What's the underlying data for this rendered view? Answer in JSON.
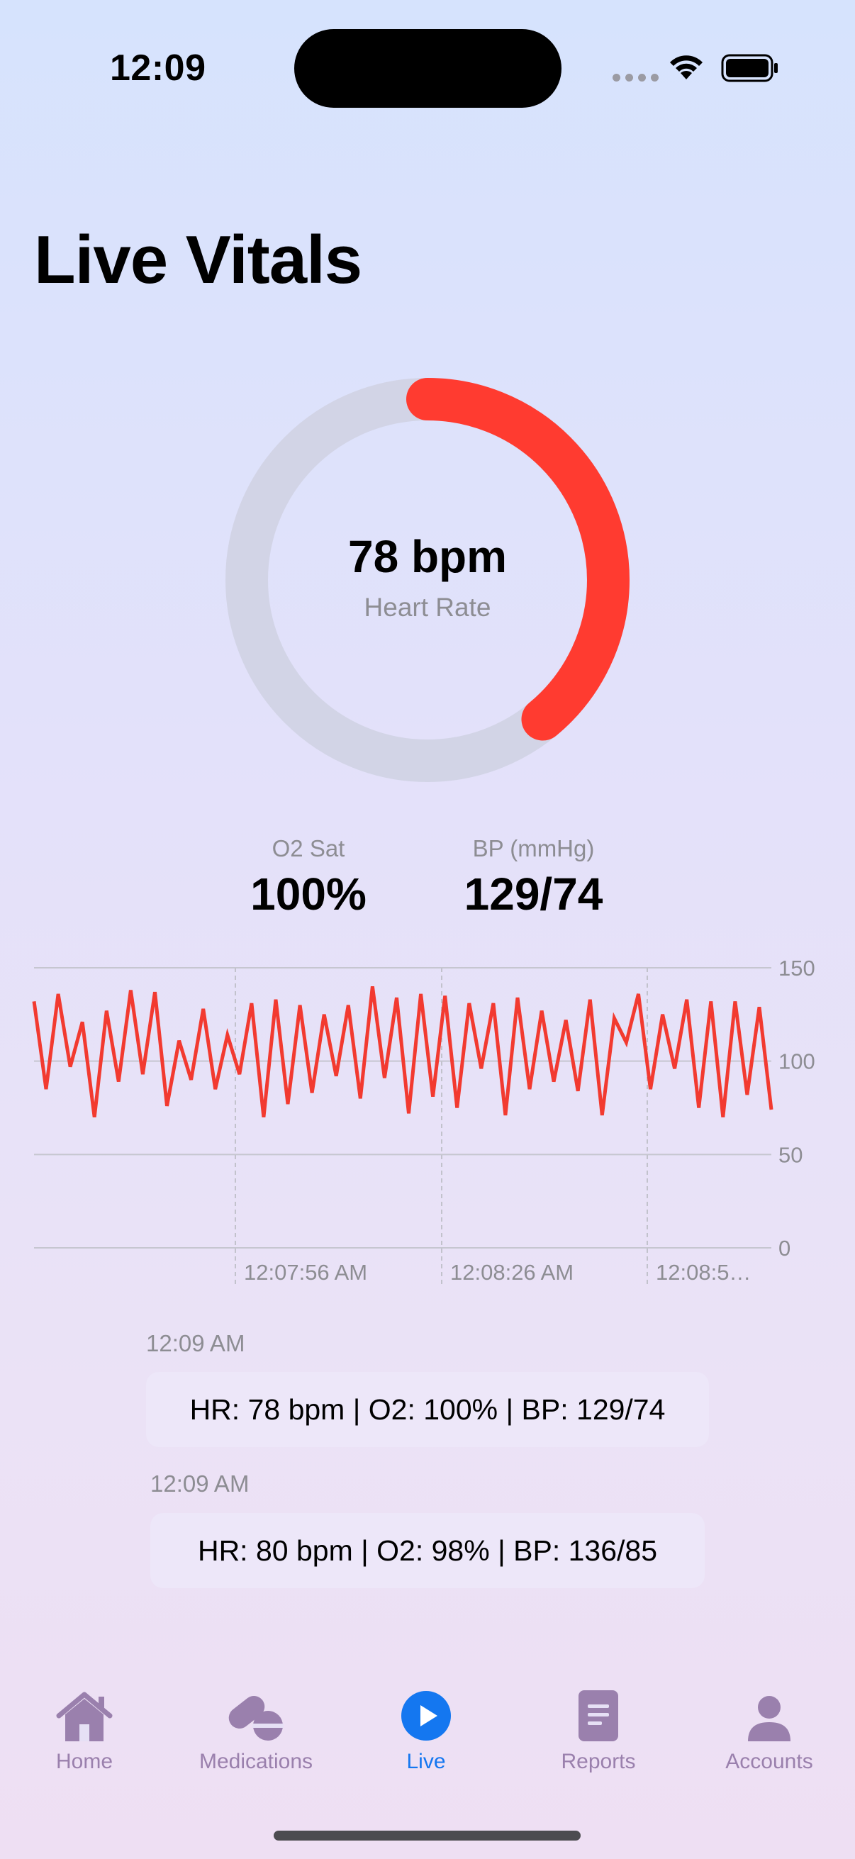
{
  "status_bar": {
    "time": "12:09",
    "icons": [
      "cellular-dots-icon",
      "wifi-icon",
      "battery-icon"
    ]
  },
  "page": {
    "title": "Live Vitals"
  },
  "heart_rate": {
    "value": "78 bpm",
    "label": "Heart Rate",
    "ring_fraction": 0.39,
    "ring_color": "#ff3b30",
    "track_color": "#d2d4e6"
  },
  "stats": {
    "o2": {
      "label": "O2 Sat",
      "value": "100%"
    },
    "bp": {
      "label": "BP (mmHg)",
      "value": "129/74"
    }
  },
  "chart_data": {
    "type": "line",
    "title": "",
    "xlabel": "",
    "ylabel": "",
    "ylim": [
      0,
      150
    ],
    "y_ticks": [
      "150",
      "100",
      "50",
      "0"
    ],
    "x_tick_labels": [
      "12:07:56 AM",
      "12:08:26 AM",
      "12:08:5…"
    ],
    "grid": true,
    "series_color": "#f23a30",
    "series": [
      {
        "values": [
          132,
          85,
          136,
          97,
          121,
          70,
          127,
          89,
          138,
          93,
          137,
          76,
          111,
          90,
          128,
          85,
          114,
          93,
          131,
          70,
          133,
          77,
          130,
          83,
          125,
          92,
          130,
          80,
          140,
          91,
          134,
          72,
          136,
          81,
          135,
          75,
          131,
          96,
          131,
          71,
          134,
          85,
          127,
          89,
          122,
          84,
          133,
          71,
          123,
          110,
          136,
          85,
          125,
          96,
          133,
          75,
          132,
          70,
          132,
          82,
          129,
          74
        ]
      }
    ]
  },
  "log": [
    {
      "time": "12:09 AM",
      "text": "HR: 78 bpm | O2: 100% | BP: 129/74"
    },
    {
      "time": "12:09 AM",
      "text": "HR: 80 bpm | O2: 98% | BP: 136/85"
    }
  ],
  "tabs": [
    {
      "label": "Home",
      "icon": "house-icon",
      "active": false
    },
    {
      "label": "Medications",
      "icon": "pills-icon",
      "active": false
    },
    {
      "label": "Live",
      "icon": "play-circle-icon",
      "active": true
    },
    {
      "label": "Reports",
      "icon": "document-icon",
      "active": false
    },
    {
      "label": "Accounts",
      "icon": "person-icon",
      "active": false
    }
  ],
  "colors": {
    "accent": "#1477f0",
    "inactive_tab": "#9a80ad"
  }
}
